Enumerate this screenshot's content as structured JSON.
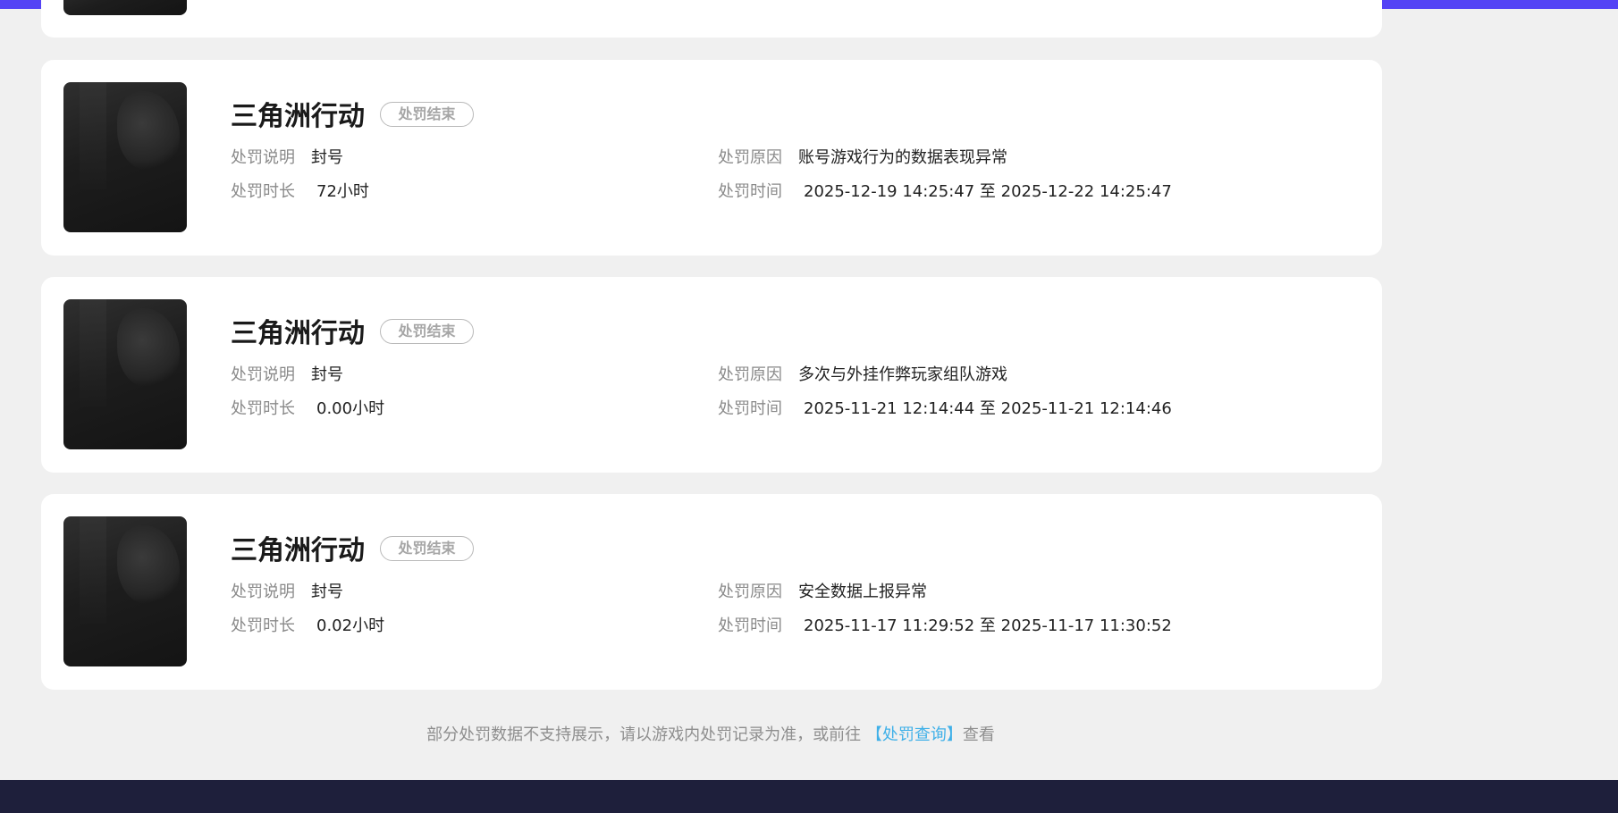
{
  "colors": {
    "topbar": "#5443f5",
    "tab_indicator": "#40c8ff",
    "page_bg": "#f0f0f0",
    "card_bg": "#ffffff",
    "link": "#3fb0e8",
    "footer_bg": "#1e1f3b"
  },
  "labels": {
    "description": "处罚说明",
    "duration": "处罚时长",
    "reason": "处罚原因",
    "time": "处罚时间"
  },
  "records": [
    {
      "game": "三角洲行动",
      "status": "处罚结束",
      "description": "封号",
      "duration": "72小时",
      "reason": "账号游戏行为的数据表现异常",
      "time": "2025-12-19 14:25:47 至 2025-12-22 14:25:47"
    },
    {
      "game": "三角洲行动",
      "status": "处罚结束",
      "description": "封号",
      "duration": "0.00小时",
      "reason": "多次与外挂作弊玩家组队游戏",
      "time": "2025-11-21 12:14:44 至 2025-11-21 12:14:46"
    },
    {
      "game": "三角洲行动",
      "status": "处罚结束",
      "description": "封号",
      "duration": "0.02小时",
      "reason": "安全数据上报异常",
      "time": "2025-11-17 11:29:52 至 2025-11-17 11:30:52"
    }
  ],
  "footer": {
    "note_prefix": "部分处罚数据不支持展示，请以游戏内处罚记录为准，或前往",
    "link_text": "【处罚查询】",
    "note_suffix": "查看"
  }
}
